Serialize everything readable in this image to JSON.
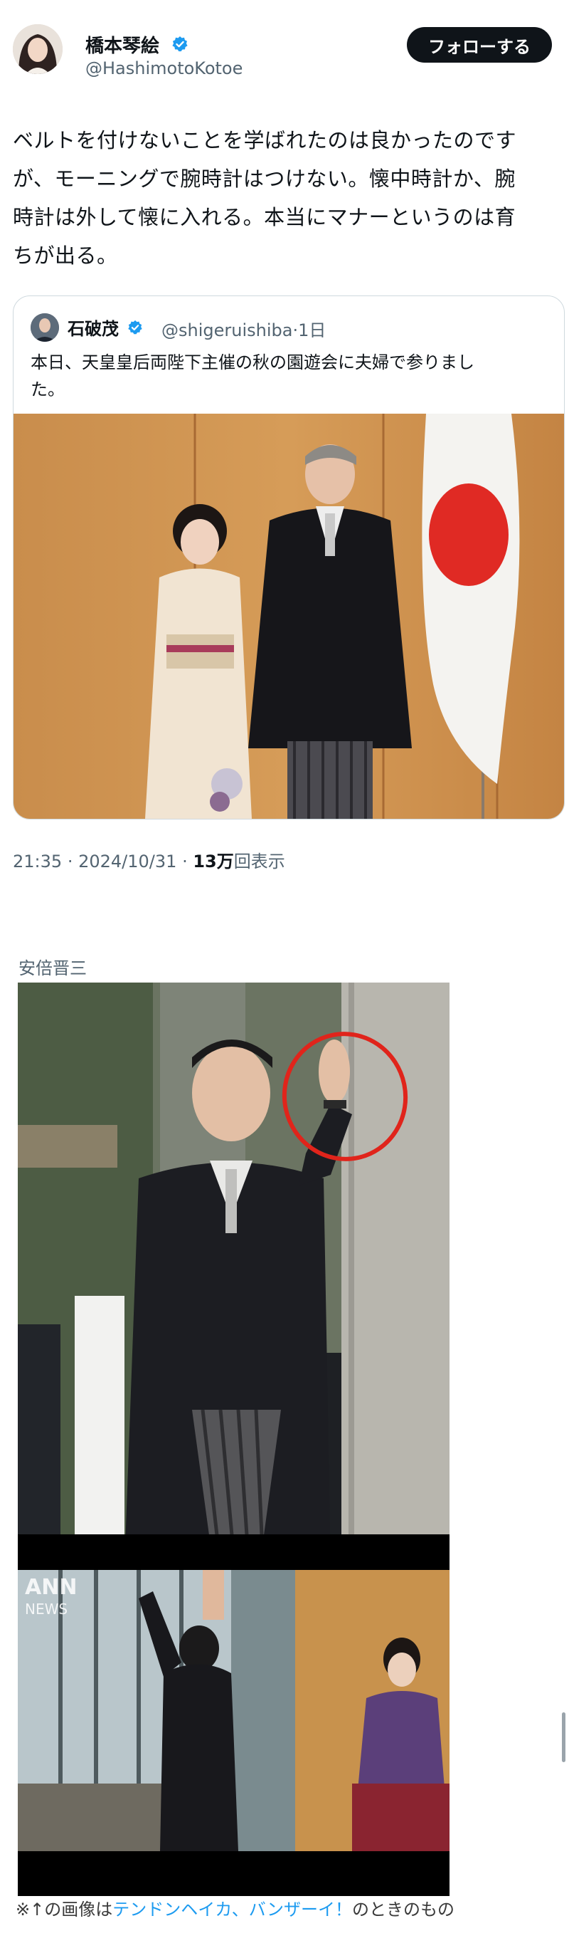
{
  "author": {
    "name": "橋本琴絵",
    "handle": "@HashimotoKotoe",
    "verified_icon": "verified-badge-icon"
  },
  "follow_button": {
    "label": "フォローする"
  },
  "tweet": {
    "lines": [
      "ベルトを付けないことを学ばれたのは良かったのです",
      "が、モーニングで腕時計はつけない。懐中時計か、腕",
      "時計は外して懐に入れる。本当にマナーというのは育",
      "ちが出る。"
    ]
  },
  "quote": {
    "name": "石破茂",
    "handle": "@shigeruishiba",
    "time": "1日",
    "text_lines": [
      "本日、天皇皇后両陛下主催の秋の園遊会に夫婦で参りまし",
      "た。"
    ]
  },
  "meta": {
    "time": "21:35",
    "date": "2024/10/31",
    "views_count": "13万",
    "views_suffix": "回表示"
  },
  "second_post": {
    "caption": "安倍晋三",
    "overlay_logo": "ANN NEWS",
    "footnote_prefix": "※↑の画像は",
    "footnote_link": "テンドンヘイカ、バンザーイ！",
    "footnote_suffix": "のときのもの"
  },
  "colors": {
    "link": "#1d9bf0",
    "verified": "#1d9bf0",
    "text": "#0f1419",
    "muted": "#536471",
    "annotation_circle": "#e0241b"
  }
}
